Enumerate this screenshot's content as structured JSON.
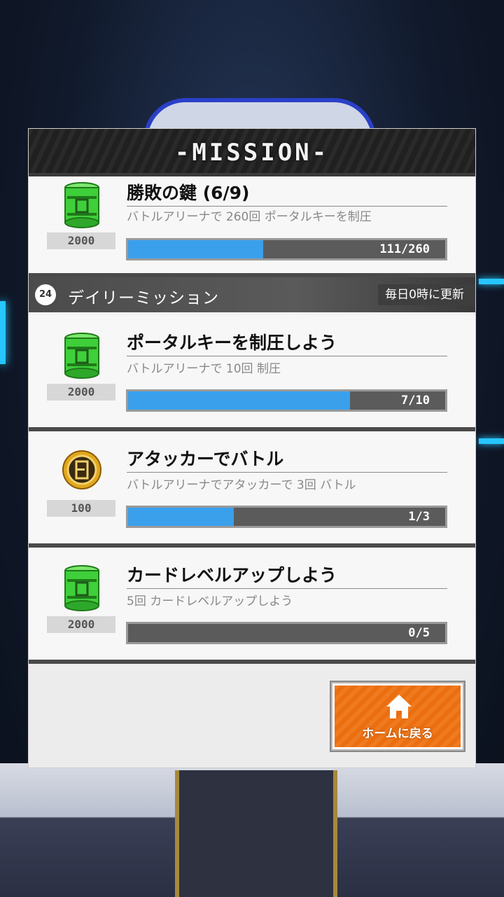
{
  "header": {
    "title": "-MISSION-"
  },
  "main_mission": {
    "title": "勝敗の鍵 (6/9)",
    "description": "バトルアリーナで 260回 ポータルキーを制圧",
    "reward": "2000",
    "reward_icon": "green-canister-icon",
    "progress_text": "111/260",
    "progress": 0.427
  },
  "daily": {
    "icon_label": "24",
    "title": "デイリーミッション",
    "note": "毎日0時に更新"
  },
  "missions": [
    {
      "title": "ポータルキーを制圧しよう",
      "description": "バトルアリーナで 10回 制圧",
      "reward": "2000",
      "reward_icon": "green-canister-icon",
      "progress_text": "7/10",
      "progress": 0.7
    },
    {
      "title": "アタッカーでバトル",
      "description": "バトルアリーナでアタッカーで 3回 バトル",
      "reward": "100",
      "reward_icon": "gold-coin-icon",
      "progress_text": "1/3",
      "progress": 0.333
    },
    {
      "title": "カードレベルアップしよう",
      "description": "5回 カードレベルアップしよう",
      "reward": "2000",
      "reward_icon": "green-canister-icon",
      "progress_text": "0/5",
      "progress": 0
    }
  ],
  "home_button": {
    "label": "ホームに戻る",
    "icon": "home-icon"
  },
  "colors": {
    "progress_fill": "#3aa0ec",
    "home_button": "#f07a1e",
    "canister": "#3fcf3a",
    "coin": "#e0a81e"
  }
}
